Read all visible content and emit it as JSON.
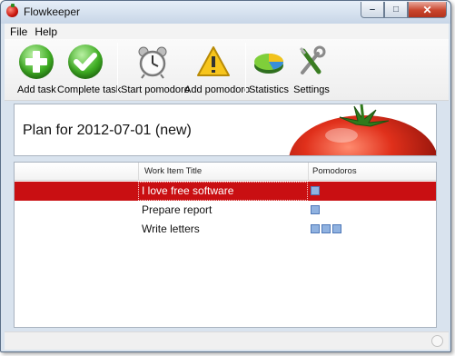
{
  "window": {
    "title": "Flowkeeper"
  },
  "menu": [
    "File",
    "Help"
  ],
  "toolbar": {
    "add_task": "Add task",
    "complete_task": "Complete task",
    "start_pomodoro": "Start pomodoro",
    "add_pomodoro": "Add pomodoro",
    "statistics": "Statistics",
    "settings": "Settings"
  },
  "plan": {
    "title": "Plan for 2012-07-01 (new)"
  },
  "table": {
    "columns": [
      "",
      "Work Item Title",
      "Pomodoros"
    ],
    "rows": [
      {
        "title": "I love free software",
        "pomodoros": 1,
        "selected": true
      },
      {
        "title": "Prepare report",
        "pomodoros": 1,
        "selected": false
      },
      {
        "title": "Write letters",
        "pomodoros": 3,
        "selected": false
      }
    ]
  },
  "colors": {
    "selection": "#c90f12",
    "pomodoro": "#90b2e0",
    "tomato": "#d4291a"
  }
}
